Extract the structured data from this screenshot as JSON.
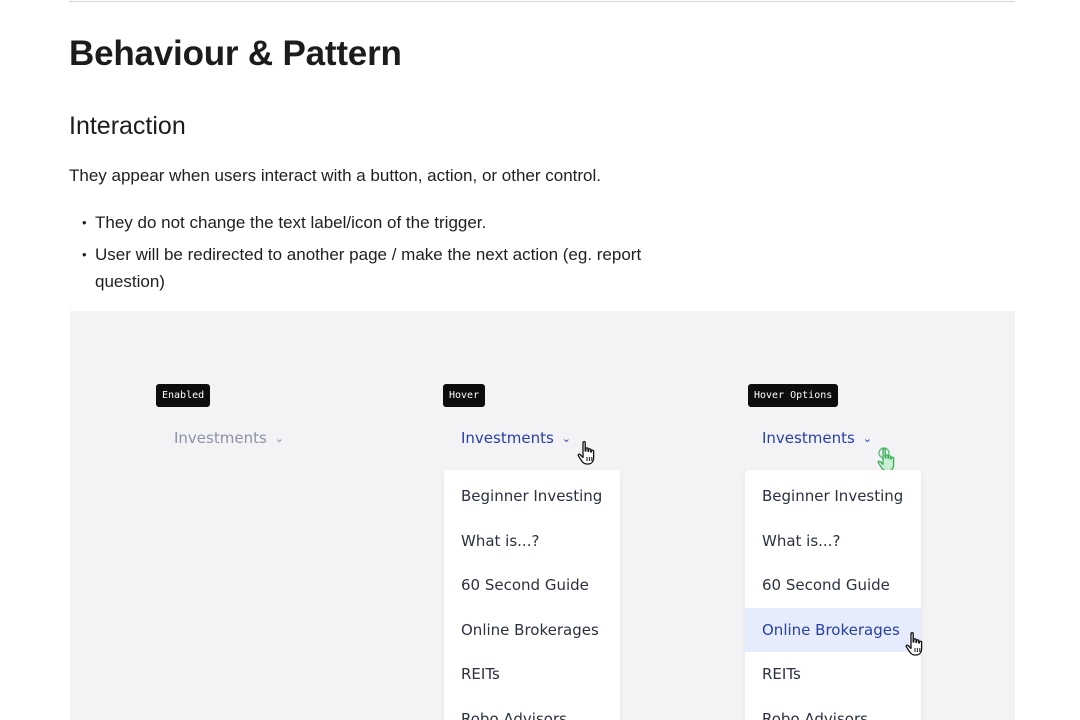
{
  "heading": "Behaviour & Pattern",
  "subheading": "Interaction",
  "intro": "They appear when users interact with a button, action, or other control.",
  "bullets": [
    "They do not change the text label/icon of the trigger.",
    "User will be redirected to another page / make the next action (eg. report question)"
  ],
  "bullet_glyph": "•",
  "states": {
    "enabled": {
      "tag": "Enabled",
      "trigger": "Investments"
    },
    "hover": {
      "tag": "Hover",
      "trigger": "Investments"
    },
    "hover_options": {
      "tag": "Hover Options",
      "trigger": "Investments",
      "active_item": "Online Brokerages"
    }
  },
  "menu_items": [
    "Beginner Investing",
    "What is...?",
    "60 Second Guide",
    "Online Brokerages",
    "REITs",
    "Robo Advisors"
  ],
  "icons": {
    "chevron": "chevron-down-icon",
    "cursor": "hand-pointer-icon",
    "chevron_glyph": "⌄"
  },
  "colors": {
    "link_blue": "#2741a8",
    "muted": "#8a93a6",
    "active_bg": "#e6ecfb",
    "tag_bg": "#0d0d0d",
    "panel_bg": "#f3f3f5",
    "cursor_press": "#5cc47a"
  }
}
